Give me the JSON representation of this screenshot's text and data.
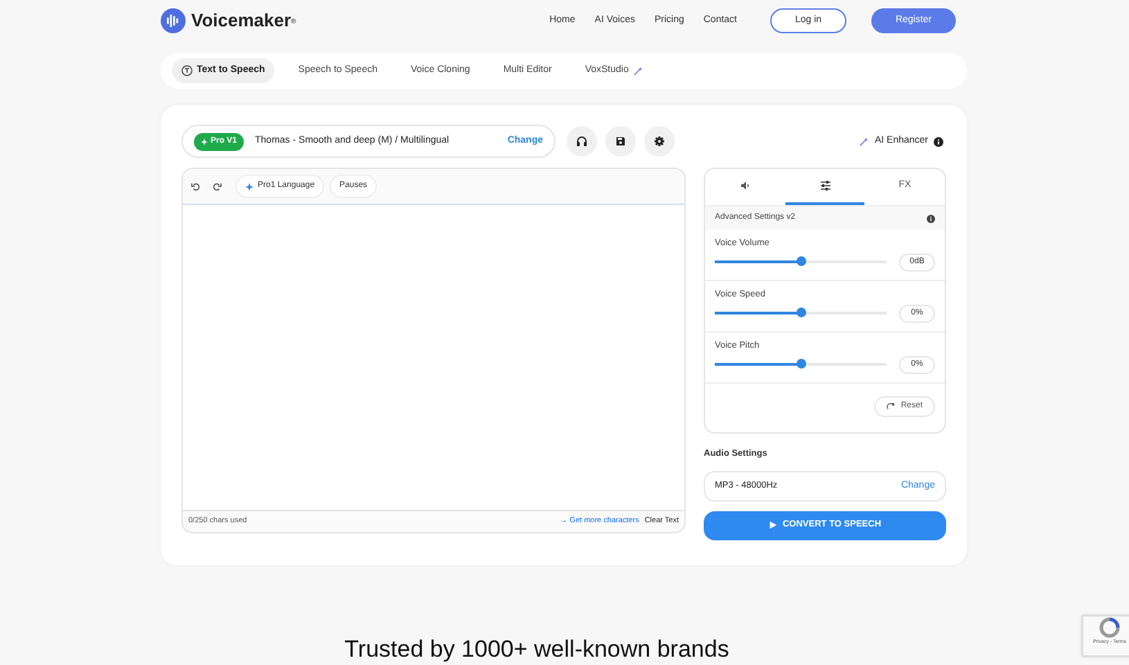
{
  "brand": {
    "name": "Voicemaker",
    "mark": "®"
  },
  "nav": [
    "Home",
    "AI Voices",
    "Pricing",
    "Contact"
  ],
  "auth": {
    "login": "Log in",
    "register": "Register"
  },
  "modes": [
    {
      "label": "Text to Speech",
      "selected": true
    },
    {
      "label": "Speech to Speech",
      "selected": false
    },
    {
      "label": "Voice Cloning",
      "selected": false
    },
    {
      "label": "Multi Editor",
      "selected": false
    },
    {
      "label": "VoxStudio",
      "selected": false
    }
  ],
  "voice": {
    "badge": "Pro V1",
    "name": "Thomas - Smooth and deep (M) / Multilingual",
    "change": "Change"
  },
  "ai_enhancer": "AI Enhancer",
  "editor": {
    "tools": [
      "Pro1 Language",
      "Pauses"
    ],
    "chars_used": "0/250 chars used",
    "more": "→ Get more characters",
    "clear": "Clear Text"
  },
  "settings_tabs": [
    {
      "kind": "speaker",
      "selected": false
    },
    {
      "kind": "sliders",
      "selected": true
    },
    {
      "kind": "text",
      "label": "FX",
      "selected": false
    }
  ],
  "settings_title": "Advanced Settings v2",
  "sliders": [
    {
      "label": "Voice Volume",
      "level": 0.5,
      "reading": "0dB"
    },
    {
      "label": "Voice Speed",
      "level": 0.5,
      "reading": "0%"
    },
    {
      "label": "Voice Pitch",
      "level": 0.5,
      "reading": "0%"
    }
  ],
  "reset": "Reset",
  "audio": {
    "title": "Audio Settings",
    "format": "MP3 - 48000Hz",
    "change": "Change"
  },
  "convert": "CONVERT TO SPEECH",
  "trusted": "Trusted by 1000+ well-known brands",
  "recaptcha": "Privacy - Terms"
}
